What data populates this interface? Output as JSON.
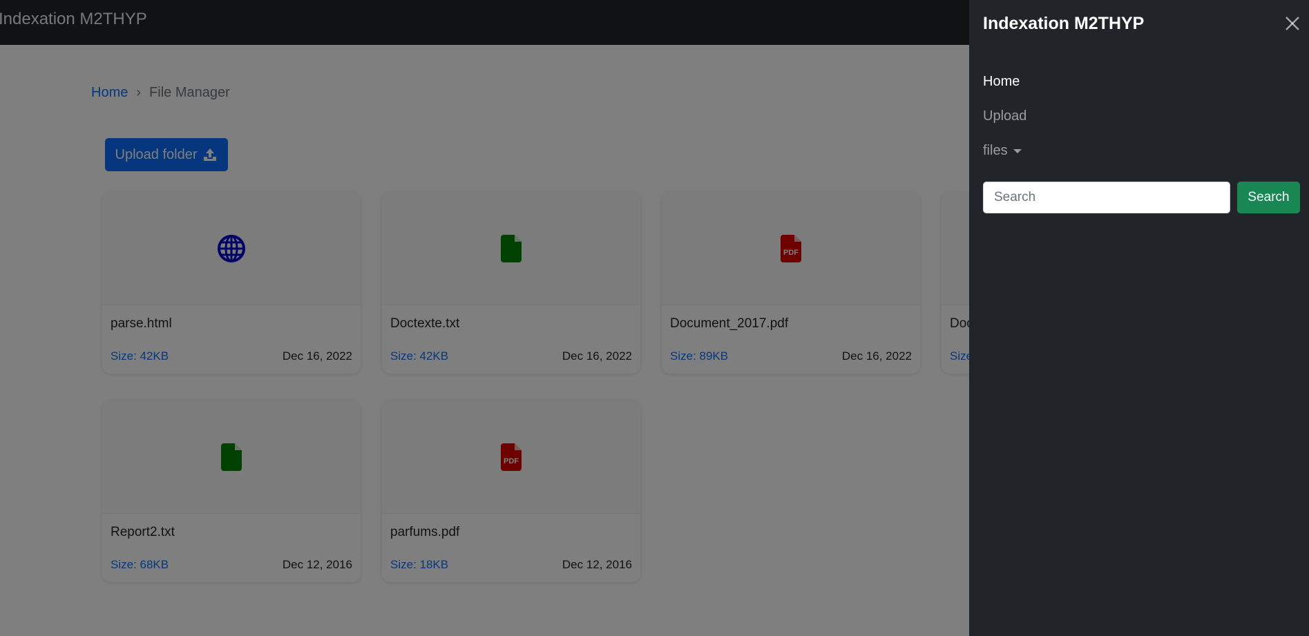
{
  "navbar": {
    "brand": "Indexation M2THYP"
  },
  "breadcrumb": {
    "home": "Home",
    "separator": "›",
    "current": "File Manager"
  },
  "upload_button": {
    "label": "Upload folder",
    "icon": "upload-icon"
  },
  "files": [
    {
      "name": "parse.html",
      "size": "Size: 42KB",
      "date": "Dec 16, 2022",
      "icon": "globe-icon",
      "icon_color": "#0000cc"
    },
    {
      "name": "Doctexte.txt",
      "size": "Size: 42KB",
      "date": "Dec 16, 2022",
      "icon": "text-file-icon",
      "icon_color": "#008000"
    },
    {
      "name": "Document_2017.pdf",
      "size": "Size: 89KB",
      "date": "Dec 16, 2022",
      "icon": "pdf-file-icon",
      "icon_color": "#dd0000"
    },
    {
      "name": "Doc",
      "size": "Size",
      "date": "",
      "icon": "file-icon",
      "icon_color": "#008000"
    },
    {
      "name": "Report2.txt",
      "size": "Size: 68KB",
      "date": "Dec 12, 2016",
      "icon": "text-file-icon",
      "icon_color": "#008000"
    },
    {
      "name": "parfums.pdf",
      "size": "Size: 18KB",
      "date": "Dec 12, 2016",
      "icon": "pdf-file-icon",
      "icon_color": "#dd0000"
    }
  ],
  "offcanvas": {
    "title": "Indexation M2THYP",
    "nav": {
      "home": "Home",
      "upload": "Upload",
      "files": "files"
    },
    "search": {
      "placeholder": "Search",
      "button": "Search"
    }
  },
  "colors": {
    "navbar_bg": "#212529",
    "primary": "#0d6efd",
    "success": "#198754",
    "pdf_red": "#dd0000",
    "txt_green": "#008000",
    "html_blue": "#0000cc"
  }
}
